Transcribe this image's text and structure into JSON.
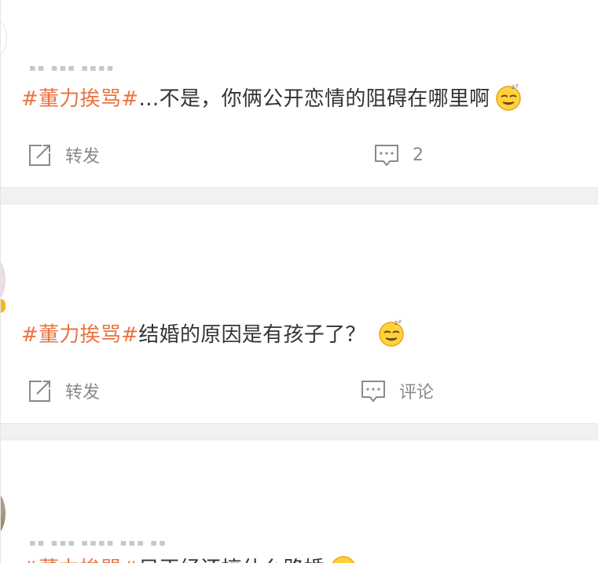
{
  "posts": [
    {
      "tag": "#董力挨骂#",
      "text": "…不是，你俩公开恋情的阻碍在哪里啊",
      "emoji_icon": "sleepy-face-icon",
      "repost_label": "转发",
      "comment_label": "2"
    },
    {
      "tag": "#董力挨骂#",
      "text": " 结婚的原因是有孩子了？",
      "emoji_icon": "sleepy-face-icon",
      "repost_label": "转发",
      "comment_label": "评论"
    },
    {
      "tag": "#董力挨骂#",
      "text": "只正经还搞什么路婚",
      "emoji_icon": "sleepy-face-icon"
    }
  ],
  "icons": {
    "repost": "share-square-arrow-icon",
    "comment": "speech-bubble-icon"
  },
  "colors": {
    "tag": "#eb7340",
    "body_text": "#333333",
    "action_text": "#8a8a8a",
    "separator": "#f1f1f1"
  }
}
